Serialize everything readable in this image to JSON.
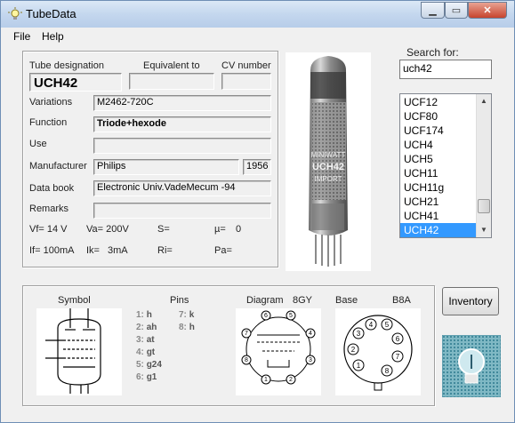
{
  "window": {
    "title": "TubeData",
    "minimize": "▁",
    "maximize": "▭",
    "close": "✕"
  },
  "menu": {
    "file": "File",
    "help": "Help"
  },
  "details": {
    "tube_designation_label": "Tube designation",
    "equivalent_label": "Equivalent to",
    "cv_label": "CV number",
    "tube_designation": "UCH42",
    "equivalent": "",
    "cv_number": "",
    "variations_label": "Variations",
    "variations": "M2462-720C",
    "function_label": "Function",
    "function": "Triode+hexode",
    "use_label": "Use",
    "use": "",
    "manufacturer_label": "Manufacturer",
    "manufacturer": "Philips",
    "year": "1956",
    "databook_label": "Data book",
    "databook": "Electronic Univ.VadeMecum -94",
    "remarks_label": "Remarks",
    "remarks": "",
    "vf": "Vf= 14 V",
    "va": "Va= 200V",
    "s": "S=",
    "mu": "µ=",
    "mu_val": "0",
    "if": "If= 100mA",
    "ik": "Ik=",
    "ik_val": "3mA",
    "ri": "Ri=",
    "pa": "Pa="
  },
  "tube_photo": {
    "icon": "tube-photo",
    "print_lines": [
      "MINIWATT",
      "UCH42",
      "IMPORT"
    ]
  },
  "search": {
    "label": "Search for:",
    "value": "uch42",
    "items": [
      "UCF12",
      "UCF80",
      "UCF174",
      "UCH4",
      "UCH5",
      "UCH11",
      "UCH11g",
      "UCH21",
      "UCH41",
      "UCH42"
    ],
    "selected": "UCH42"
  },
  "bottom": {
    "symbol_label": "Symbol",
    "pins_label": "Pins",
    "diagram_label": "Diagram",
    "diagram_code": "8GY",
    "base_label": "Base",
    "base_code": "B8A",
    "pins": [
      {
        "n": "1:",
        "v": "h"
      },
      {
        "n": "2:",
        "v": "ah"
      },
      {
        "n": "3:",
        "v": "at"
      },
      {
        "n": "4:",
        "v": "gt"
      },
      {
        "n": "5:",
        "v": "g24"
      },
      {
        "n": "6:",
        "v": "g1"
      }
    ],
    "pins_right": [
      {
        "n": "7:",
        "v": "k"
      },
      {
        "n": "8:",
        "v": "h"
      }
    ],
    "base_pins": [
      "1",
      "2",
      "3",
      "4",
      "5",
      "6",
      "7",
      "8"
    ]
  },
  "inventory_button": "Inventory"
}
